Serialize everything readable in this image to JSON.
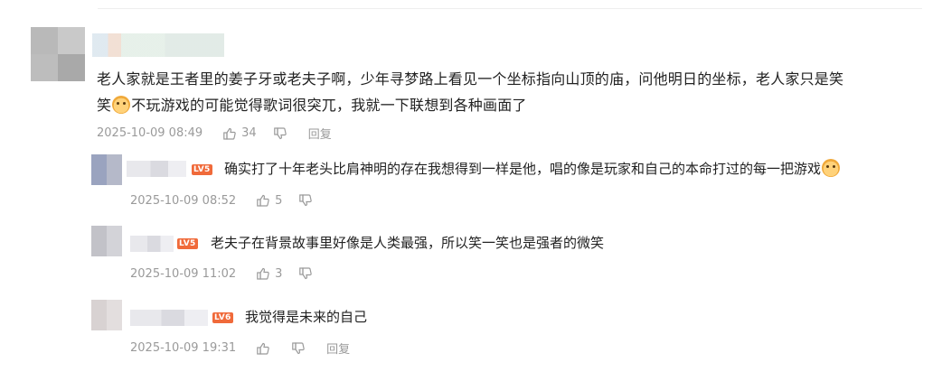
{
  "main_comment": {
    "text_line1": "老人家就是王者里的姜子牙或老夫子啊，少年寻梦路上看见一个坐标指向山顶的庙，问他明日的坐标，老人家只是笑",
    "text_line2_prefix": "笑",
    "text_line2_suffix": "不玩游戏的可能觉得歌词很突兀，我就一下联想到各种画面了",
    "emoji": "dog-face-emoji",
    "time": "2025-10-09 08:49",
    "likes": "34",
    "reply_label": "回复"
  },
  "replies": [
    {
      "level": "LV5",
      "text": "确实打了十年老头比肩神明的存在我想得到一样是他，唱的像是玩家和自己的本命打过的每一把游戏",
      "emoji": "dog-face-emoji",
      "time": "2025-10-09 08:52",
      "likes": "5"
    },
    {
      "level": "LV5",
      "text": "老夫子在背景故事里好像是人类最强，所以笑一笑也是强者的微笑",
      "time": "2025-10-09 11:02",
      "likes": "3"
    },
    {
      "level": "LV6",
      "text": "我觉得是未来的自己",
      "time": "2025-10-09 19:31",
      "likes": "",
      "reply_label": "回复"
    }
  ],
  "icons": {
    "like": "thumbs-up-icon",
    "dislike": "thumbs-down-icon"
  },
  "colors": {
    "meta_gray": "#9a9a9a",
    "level_badge": "#f06a3a",
    "text": "#222222"
  }
}
